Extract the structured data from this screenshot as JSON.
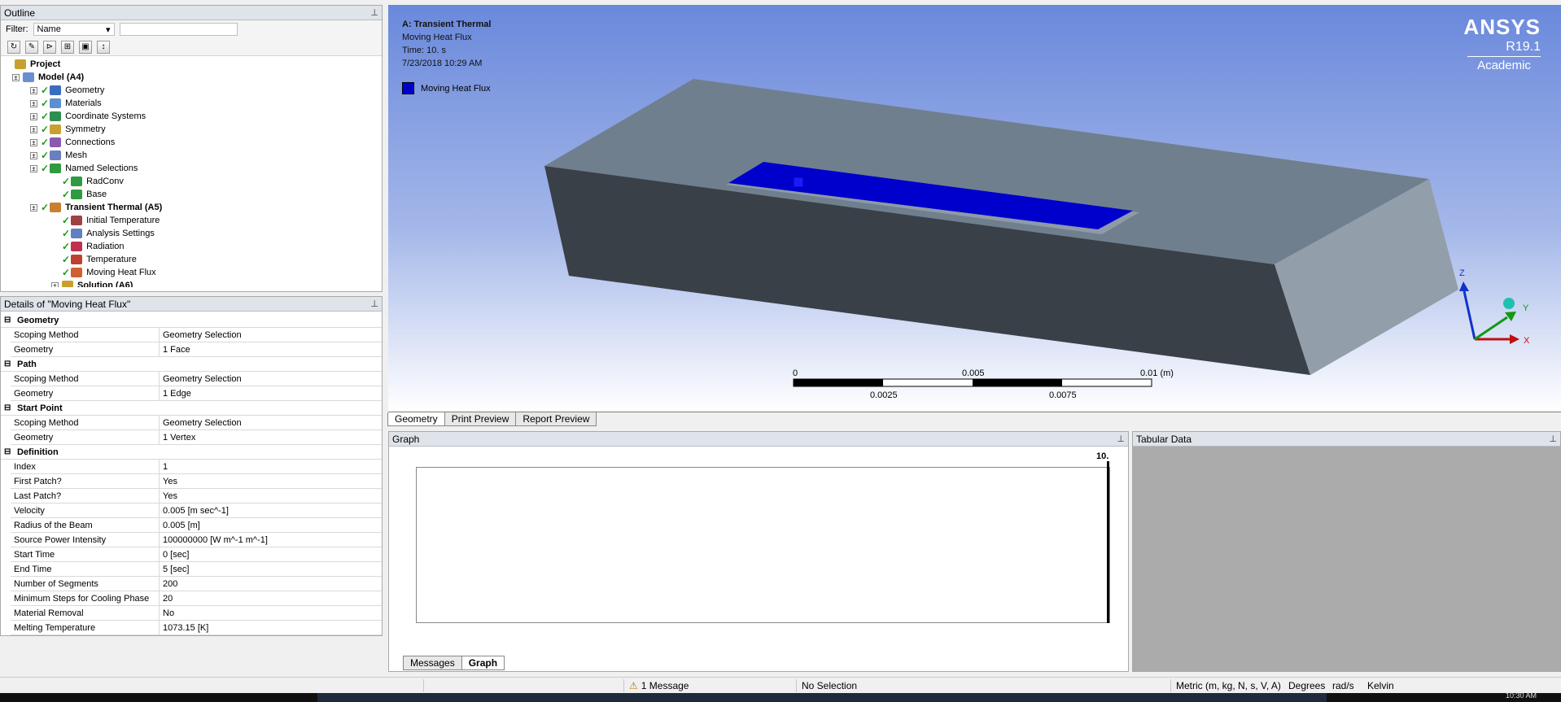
{
  "outline": {
    "title": "Outline",
    "filter_label": "Filter:",
    "filter_value": "Name",
    "tree": [
      {
        "label": "Project",
        "bold": true,
        "icon": "project-icon"
      },
      {
        "label": "Model (A4)",
        "bold": true,
        "icon": "model-icon"
      },
      {
        "label": "Geometry",
        "icon": "geometry-icon"
      },
      {
        "label": "Materials",
        "icon": "materials-icon"
      },
      {
        "label": "Coordinate Systems",
        "icon": "coordinate-systems-icon"
      },
      {
        "label": "Symmetry",
        "icon": "symmetry-icon"
      },
      {
        "label": "Connections",
        "icon": "connections-icon"
      },
      {
        "label": "Mesh",
        "icon": "mesh-icon"
      },
      {
        "label": "Named Selections",
        "icon": "named-selections-icon"
      },
      {
        "label": "RadConv",
        "icon": "named-selection-icon"
      },
      {
        "label": "Base",
        "icon": "named-selection-icon"
      },
      {
        "label": "Transient Thermal (A5)",
        "bold": true,
        "icon": "transient-thermal-icon"
      },
      {
        "label": "Initial Temperature",
        "icon": "initial-temperature-icon"
      },
      {
        "label": "Analysis Settings",
        "icon": "analysis-settings-icon"
      },
      {
        "label": "Radiation",
        "icon": "radiation-icon"
      },
      {
        "label": "Temperature",
        "icon": "temperature-icon"
      },
      {
        "label": "Moving Heat Flux",
        "icon": "moving-heat-flux-icon"
      },
      {
        "label": "Solution (A6)",
        "bold": true,
        "icon": "solution-icon"
      }
    ]
  },
  "details": {
    "title": "Details of \"Moving Heat Flux\"",
    "groups": [
      {
        "name": "Geometry",
        "rows": [
          [
            "Scoping Method",
            "Geometry Selection"
          ],
          [
            "Geometry",
            "1 Face"
          ]
        ]
      },
      {
        "name": "Path",
        "rows": [
          [
            "Scoping Method",
            "Geometry Selection"
          ],
          [
            "Geometry",
            "1 Edge"
          ]
        ]
      },
      {
        "name": "Start Point",
        "rows": [
          [
            "Scoping Method",
            "Geometry Selection"
          ],
          [
            "Geometry",
            "1 Vertex"
          ]
        ]
      },
      {
        "name": "Definition",
        "rows": [
          [
            "Index",
            "1"
          ],
          [
            "First Patch?",
            "Yes"
          ],
          [
            "Last Patch?",
            "Yes"
          ],
          [
            "Velocity",
            "0.005 [m sec^-1]"
          ],
          [
            "Radius of the Beam",
            "0.005 [m]"
          ],
          [
            "Source Power Intensity",
            "100000000 [W m^-1 m^-1]"
          ],
          [
            "Start Time",
            "0 [sec]"
          ],
          [
            "End Time",
            "5 [sec]"
          ],
          [
            "Number of Segments",
            "200"
          ],
          [
            "Minimum Steps for Cooling Phase",
            "20"
          ],
          [
            "Material Removal",
            "No"
          ],
          [
            "Melting Temperature",
            "1073.15 [K]"
          ]
        ]
      }
    ]
  },
  "viewport": {
    "analysis": "A: Transient Thermal",
    "load": "Moving Heat Flux",
    "time": "Time: 10. s",
    "date": "7/23/2018 10:29 AM",
    "legend": "Moving Heat Flux",
    "brand": "ANSYS",
    "version": "R19.1",
    "edition": "Academic",
    "scale_labels": [
      "0",
      "0.005",
      "0.01 (m)",
      "0.0025",
      "0.0075"
    ],
    "triad": [
      "Z",
      "Y",
      "X"
    ],
    "tabs": [
      "Geometry",
      "Print Preview",
      "Report Preview"
    ]
  },
  "graph": {
    "title": "Graph",
    "max_label": "10.",
    "tabs": [
      "Messages",
      "Graph"
    ]
  },
  "tabular": {
    "title": "Tabular Data"
  },
  "status": {
    "messages": "1 Message",
    "selection": "No Selection",
    "units": "Metric (m, kg, N, s, V, A)",
    "angle": "Degrees",
    "rate": "rad/s",
    "temp": "Kelvin"
  },
  "taskbar": {
    "clock": "10:30 AM"
  },
  "colors": {
    "flux": "#0000cc",
    "block_top": "#6f7f8d",
    "block_front": "#3a4048",
    "block_side": "#939eab"
  }
}
